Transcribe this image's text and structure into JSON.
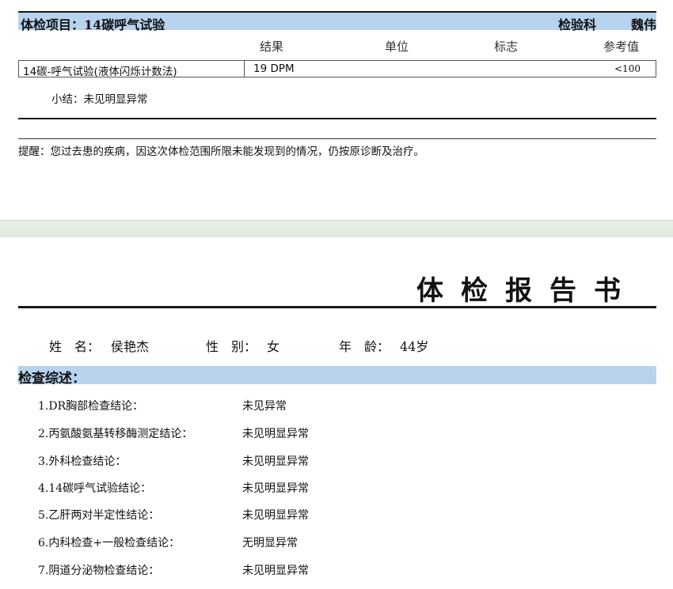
{
  "page1": {
    "project_title": "体检项目：14碳呼气试验",
    "department": "检验科",
    "doctor": "魏伟",
    "columns": {
      "result": "结果",
      "unit": "单位",
      "flag": "标志",
      "reference": "参考值"
    },
    "row": {
      "item": "14碳-呼气试验(液体闪烁计数法)",
      "result": "19  DPM",
      "unit": "",
      "flag": "",
      "reference": "<100"
    },
    "summary": "小结：未见明显异常",
    "reminder": "提醒：您过去患的疾病，因这次体检范围所限未能发现到的情况，仍按原诊断及治疗。"
  },
  "page2": {
    "title": "体检报告书",
    "patient": {
      "name_label": "姓　名：",
      "name": "侯艳杰",
      "sex_label": "性　别：",
      "sex": "女",
      "age_label": "年　龄：",
      "age": "44岁"
    },
    "section_title": "检查综述：",
    "findings": [
      {
        "label": "1.DR胸部检查结论：",
        "value": "未见异常"
      },
      {
        "label": "2.丙氨酸氨基转移酶测定结论：",
        "value": "未见明显异常"
      },
      {
        "label": "3.外科检查结论：",
        "value": "未见明显异常"
      },
      {
        "label": "4.14碳呼气试验结论：",
        "value": "未见明显异常"
      },
      {
        "label": "5.乙肝两对半定性结论：",
        "value": "未见明显异常"
      },
      {
        "label": "6.内科检查+一般检查结论：",
        "value": "无明显异常"
      },
      {
        "label": "7.阴道分泌物检查结论：",
        "value": "未见明显异常"
      }
    ]
  }
}
